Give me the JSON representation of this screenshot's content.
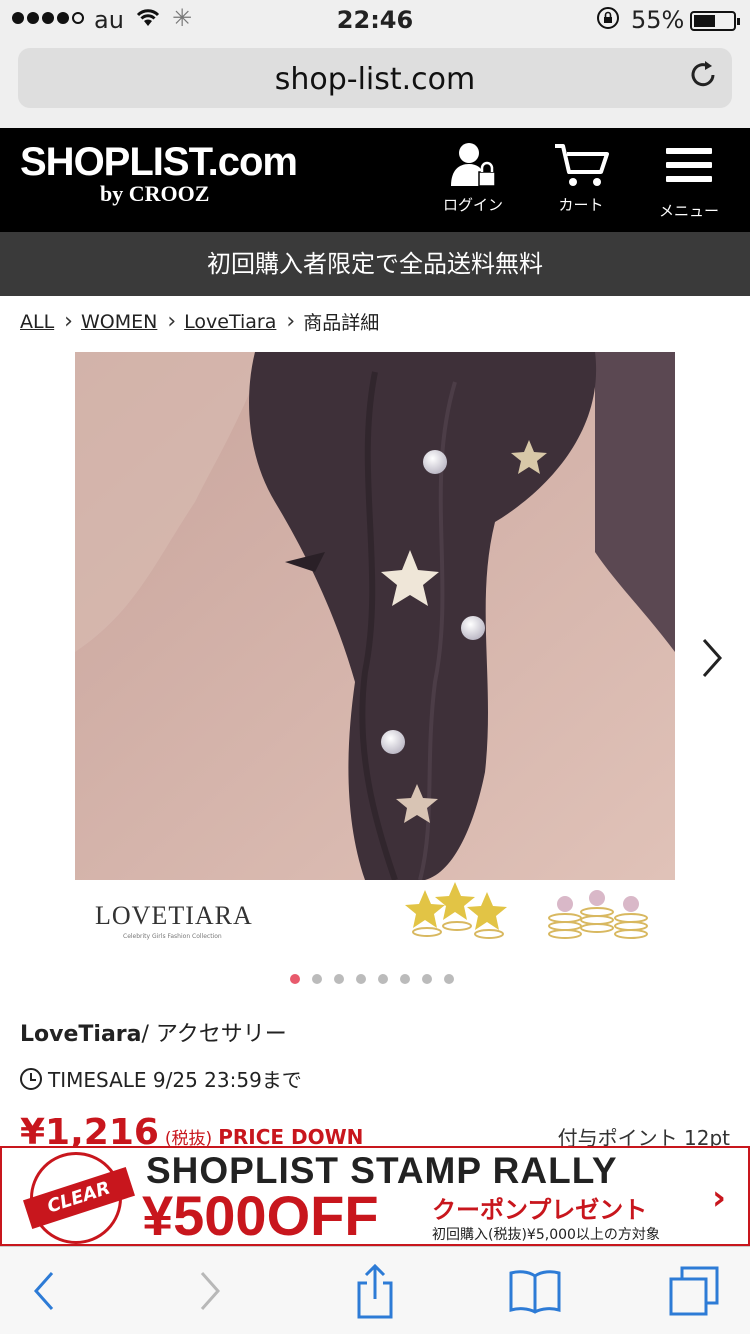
{
  "status_bar": {
    "carrier": "au",
    "time": "22:46",
    "battery_percent": "55%",
    "battery_level": 0.55,
    "signal_bars_filled": 4,
    "signal_bars_total": 5
  },
  "browser": {
    "url": "shop-list.com"
  },
  "header": {
    "logo_main": "SHOPLIST.com",
    "logo_sub": "by CROOZ",
    "login_label": "ログイン",
    "cart_label": "カート",
    "menu_label": "メニュー"
  },
  "promo": {
    "text": "初回購入者限定で全品送料無料"
  },
  "breadcrumb": {
    "items": [
      "ALL",
      "WOMEN",
      "LoveTiara"
    ],
    "current": "商品詳細"
  },
  "product": {
    "image_logo": "LOVETIARA",
    "image_logo_sub": "Celebrity Girls Fashion Collection",
    "carousel_dots": 8,
    "carousel_active": 0,
    "brand": "LoveTiara",
    "category": "/ アクセサリー",
    "timesale": "TIMESALE 9/25 23:59まで",
    "price": "¥1,216",
    "tax_note": "(税抜)",
    "price_down": "PRICE DOWN",
    "points_label": "付与ポイント",
    "points_value": "12pt"
  },
  "banner": {
    "badge": "CLEAR",
    "title": "SHOPLIST STAMP RALLY",
    "amount": "¥500OFF",
    "coupon": "クーポンプレゼント",
    "condition": "初回購入(税抜)¥5,000以上の方対象"
  },
  "colors": {
    "accent_red": "#c8161d",
    "header_bg": "#000000",
    "promo_bg": "#3a3a3a",
    "ios_blue": "#2d7bd6",
    "active_dot": "#e85a6c"
  },
  "icons": {
    "toolbar": [
      "back-icon",
      "forward-icon",
      "share-icon",
      "bookmarks-icon",
      "tabs-icon"
    ]
  }
}
